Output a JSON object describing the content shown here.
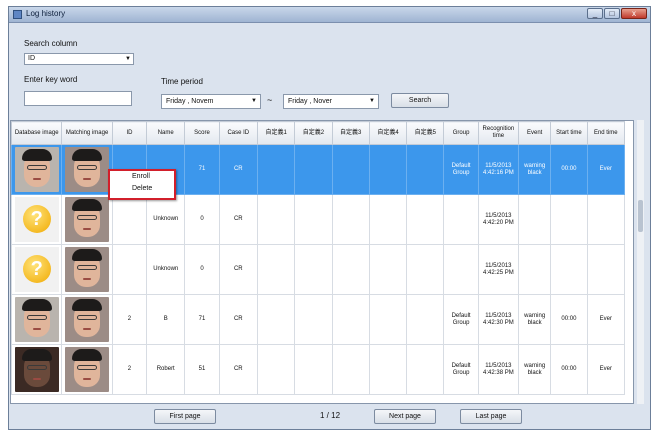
{
  "window": {
    "title": "Log history",
    "buttons": [
      "_",
      "□",
      "x"
    ]
  },
  "search": {
    "column_label": "Search column",
    "column_value": "ID",
    "keyword_label": "Enter key word",
    "keyword_value": "",
    "time_label": "Time period",
    "from": {
      "day": "Friday",
      "month": ", Novem"
    },
    "separator": "~",
    "to": {
      "day": "Friday",
      "month": ", Nover"
    },
    "search_button": "Search"
  },
  "grid": {
    "columns": [
      "Database image",
      "Matching image",
      "ID",
      "Name",
      "Score",
      "Case ID",
      "自定義1",
      "自定義2",
      "自定義3",
      "自定義4",
      "自定義5",
      "Group",
      "Recognition time",
      "Event",
      "Start time",
      "End time"
    ],
    "rows": [
      {
        "db": "face",
        "match": "face",
        "id": "",
        "name": "",
        "score": "71",
        "case": "CR",
        "group": "Default Group",
        "time": "11/5/2013 4:42:16 PM",
        "event": "warning black",
        "start": "00:00",
        "end": "Ever",
        "selected": true
      },
      {
        "db": "unknown",
        "match": "face",
        "id": "",
        "name": "Unknown",
        "score": "0",
        "case": "CR",
        "group": "",
        "time": "11/5/2013 4:42:20 PM",
        "event": "",
        "start": "",
        "end": "",
        "selected": false
      },
      {
        "db": "unknown",
        "match": "face",
        "id": "",
        "name": "Unknown",
        "score": "0",
        "case": "CR",
        "group": "",
        "time": "11/5/2013 4:42:25 PM",
        "event": "",
        "start": "",
        "end": "",
        "selected": false
      },
      {
        "db": "face",
        "match": "face",
        "id": "2",
        "name": "B",
        "score": "71",
        "case": "CR",
        "group": "Default Group",
        "time": "11/5/2013 4:42:30 PM",
        "event": "warning black",
        "start": "00:00",
        "end": "Ever",
        "selected": false
      },
      {
        "db": "face-dark",
        "match": "face",
        "id": "2",
        "name": "Robert",
        "score": "51",
        "case": "CR",
        "group": "Default Group",
        "time": "11/5/2013 4:42:38 PM",
        "event": "warning black",
        "start": "00:00",
        "end": "Ever",
        "selected": false
      }
    ]
  },
  "context_menu": {
    "items": [
      "Enroll",
      "Delete"
    ]
  },
  "pager": {
    "first": "First page",
    "info": "1 / 12",
    "next": "Next page",
    "last": "Last page"
  },
  "colors": {
    "selection": "#3c97ec",
    "highlight_border": "#d21f2b"
  }
}
